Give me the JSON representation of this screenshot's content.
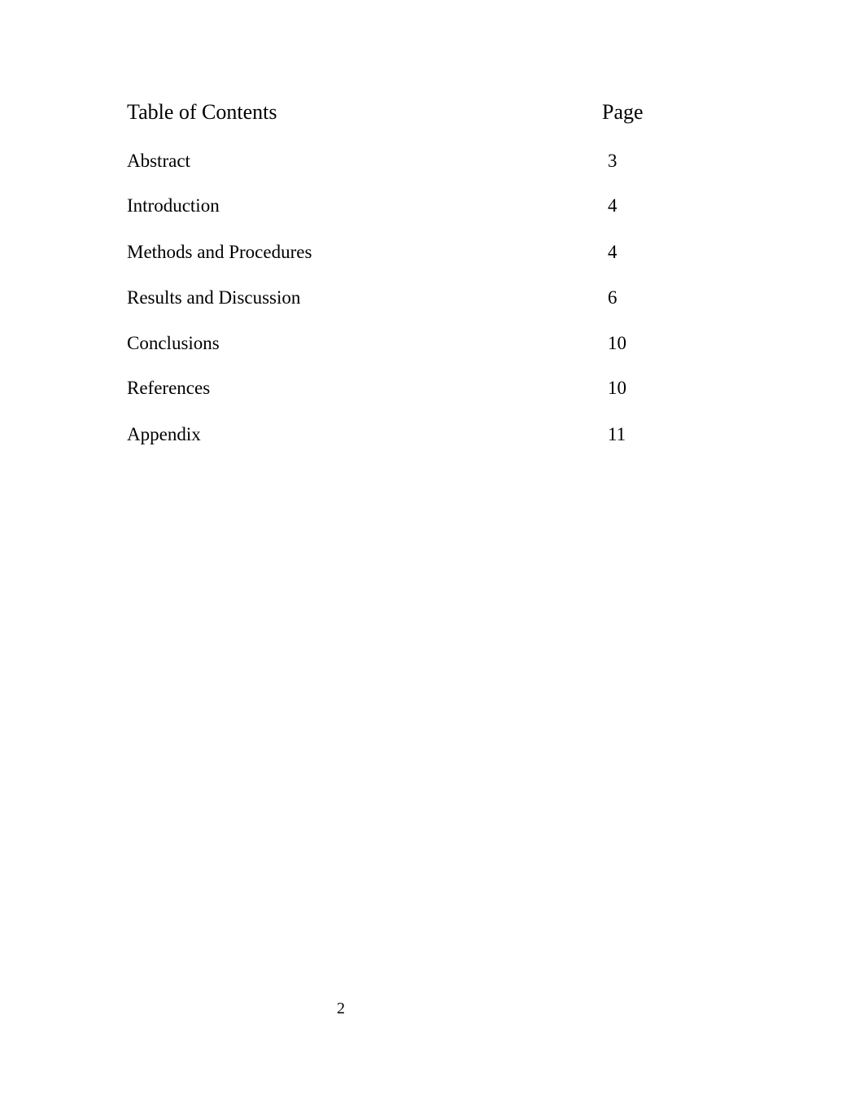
{
  "toc": {
    "heading": "Table of Contents",
    "page_heading": "Page",
    "entries": [
      {
        "title": "Abstract",
        "page": "3"
      },
      {
        "title": "Introduction",
        "page": "4"
      },
      {
        "title": "Methods and Procedures",
        "page": "4"
      },
      {
        "title": "Results and Discussion",
        "page": "6"
      },
      {
        "title": "Conclusions",
        "page": "10"
      },
      {
        "title": "References",
        "page": "10"
      },
      {
        "title": "Appendix",
        "page": "11"
      }
    ]
  },
  "footer": {
    "page_number": "2"
  }
}
